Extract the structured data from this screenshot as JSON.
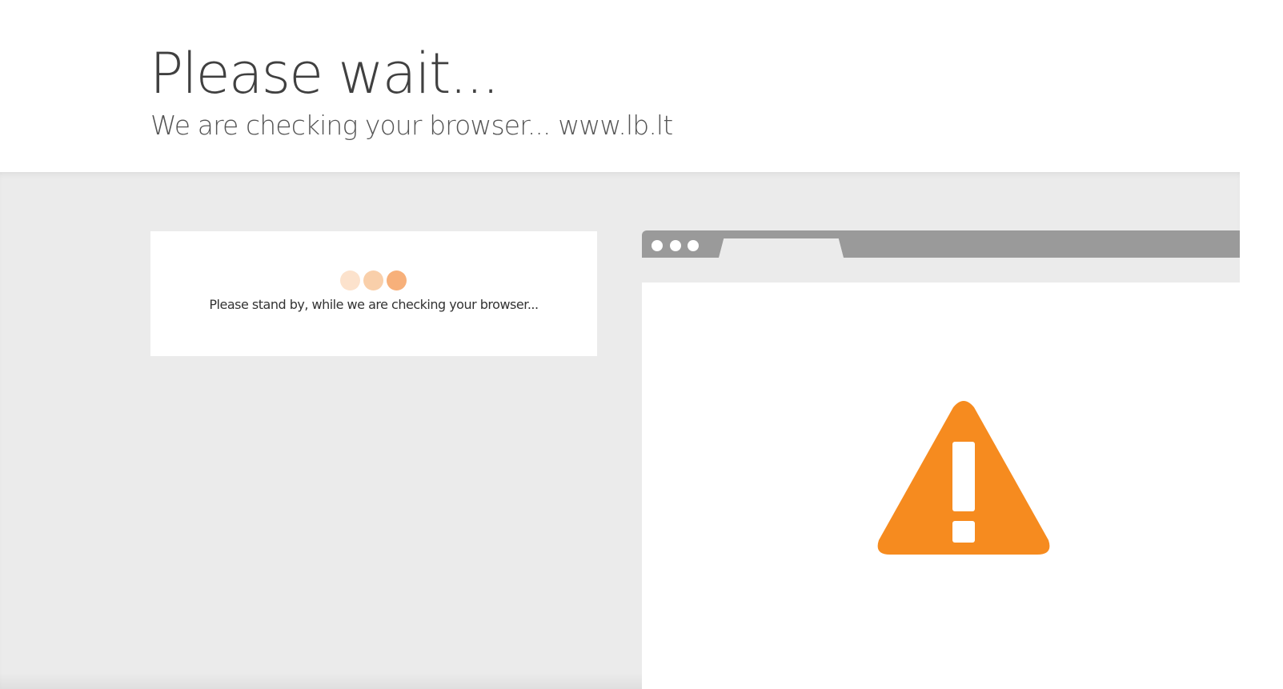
{
  "header": {
    "title": "Please wait...",
    "subtitle": "We are checking your browser... www.lb.lt"
  },
  "status_card": {
    "message": "Please stand by, while we are checking your browser...",
    "loader_colors": [
      "#fce2cc",
      "#f9cfaa",
      "#f7b07a"
    ]
  },
  "browser_illustration": {
    "chrome_color": "#9a9a9a",
    "warning_icon": "warning-triangle-icon",
    "warning_color": "#f68b1f"
  },
  "colors": {
    "page_background": "#ebebeb",
    "header_background": "#ffffff",
    "card_background": "#ffffff",
    "accent": "#f68b1f"
  }
}
